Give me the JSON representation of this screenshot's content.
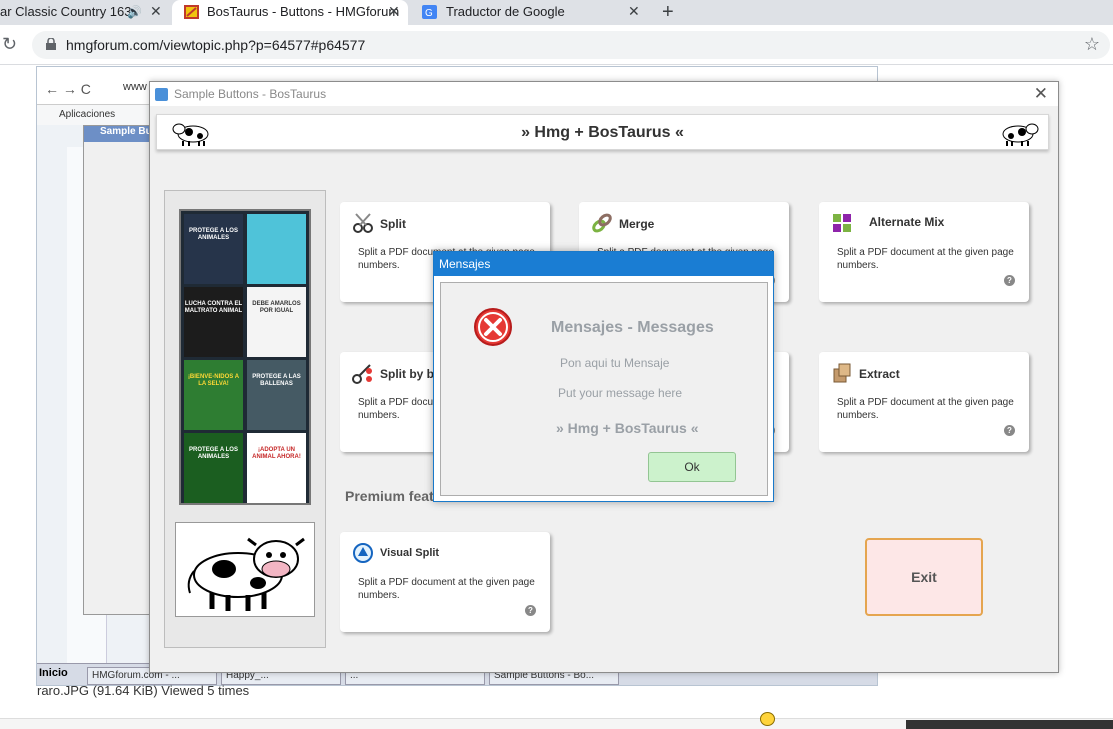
{
  "browser": {
    "tabs": [
      {
        "title": "ar Classic Country 163",
        "active": false
      },
      {
        "title": "BosTaurus - Buttons - HMGforum",
        "active": true
      },
      {
        "title": "Traductor de Google",
        "active": false
      }
    ],
    "url": "hmgforum.com/viewtopic.php?p=64577#p64577"
  },
  "forum": {
    "caption": "raro.JPG (91.64 KiB) Viewed 5 times",
    "inner_url": "www",
    "bookmarks": "Aplicaciones",
    "bg_window_title": "Sample Bu",
    "taskbar": {
      "start": "Inicio",
      "items": [
        "HMGforum.com - ...",
        "Happy_...",
        "...",
        "Sample Buttons - Bo..."
      ]
    }
  },
  "app": {
    "title": "Sample Buttons - BosTaurus",
    "banner": "»  Hmg + BosTaurus  «",
    "cards": [
      {
        "title": "Split",
        "desc": "Split a PDF document at the given page numbers.",
        "icon": "scissors-icon"
      },
      {
        "title": "Merge",
        "desc": "Split a PDF document at the given page numbers.",
        "icon": "merge-icon"
      },
      {
        "title": "Alternate Mix",
        "desc": "Split a PDF document at the given page numbers.",
        "icon": "alternate-mix-icon"
      },
      {
        "title": "Split by bookmarks",
        "desc": "Split a PDF document at the given page numbers.",
        "icon": "split-bookmarks-icon"
      },
      {
        "title": "Extract",
        "desc": "Split a PDF document at the given page numbers.",
        "icon": "extract-icon"
      },
      {
        "title": "Visual Split",
        "desc": "Split a PDF document at the given page numbers.",
        "icon": "visual-split-icon"
      }
    ],
    "premium_label": "Premium features",
    "exit_label": "Exit",
    "thumbnails": [
      "PROTEGE A LOS ANIMALES",
      "",
      "LUCHA CONTRA EL MALTRATO ANIMAL",
      "DEBE AMARLOS POR IGUAL",
      "¡BIENVE-NIDOS A LA SELVA!",
      "PROTEGE A LAS BALLENAS",
      "PROTEGE A LOS ANIMALES",
      "¡ADOPTA UN ANIMAL AHORA!"
    ]
  },
  "dialog": {
    "title": "Mensajes",
    "heading": "Mensajes - Messages",
    "line1": "Pon aqui tu Mensaje",
    "line2": "Put your message here",
    "line3": "»  Hmg + BosTaurus  «",
    "ok_label": "Ok"
  },
  "colors": {
    "dialog_titlebar": "#1a7dd3",
    "ok_button": "#ccf2cc",
    "exit_button": "#fde7e7",
    "exit_border": "#e5a54f"
  }
}
